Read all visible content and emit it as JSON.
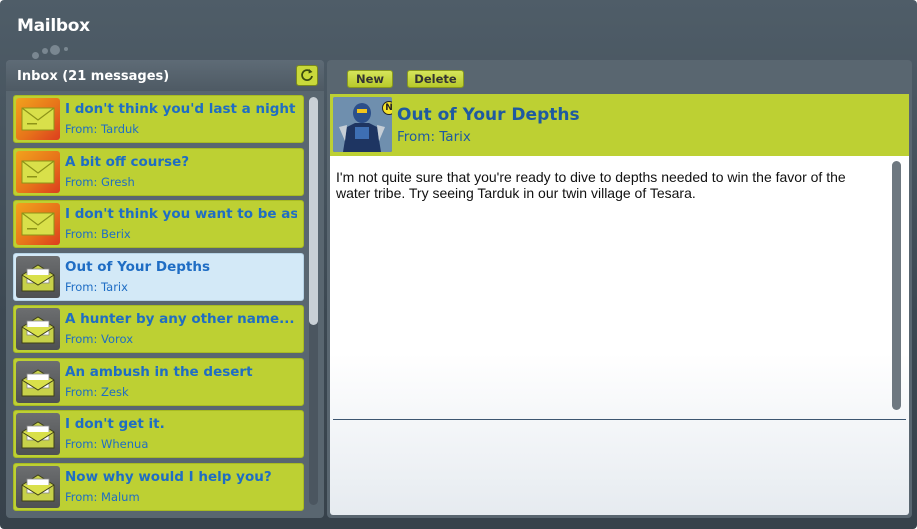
{
  "window": {
    "title": "Mailbox"
  },
  "inbox": {
    "title": "Inbox (21 messages)",
    "messages": [
      {
        "subject": "I don't think you'd last a night in the",
        "from": "From: Tarduk",
        "unread": true
      },
      {
        "subject": "A bit off course?",
        "from": "From: Gresh",
        "unread": true
      },
      {
        "subject": "I don't think you want to be associated",
        "from": "From: Berix",
        "unread": true
      },
      {
        "subject": "Out of Your Depths",
        "from": "From: Tarix",
        "unread": false,
        "selected": true
      },
      {
        "subject": "A hunter by any other name...",
        "from": "From: Vorox",
        "unread": false
      },
      {
        "subject": "An ambush in the desert",
        "from": "From: Zesk",
        "unread": false
      },
      {
        "subject": "I don't get it.",
        "from": "From: Whenua",
        "unread": false
      },
      {
        "subject": "Now why would I help you?",
        "from": "From: Malum",
        "unread": false
      }
    ]
  },
  "toolbar": {
    "new_label": "New",
    "delete_label": "Delete"
  },
  "reader": {
    "badge": "N",
    "subject": "Out of Your Depths",
    "from": "From: Tarix",
    "body": "I'm not quite sure that you're ready to dive to depths needed to win the favor of the water tribe. Try seeing Tarduk in our twin village of Tesara."
  },
  "colors": {
    "accent": "#bdd033",
    "link": "#1f6dc4",
    "chrome": "#3c4852",
    "selected": "#d3e9f7",
    "unread_icon": "#e7741a"
  },
  "icons": {
    "refresh": "refresh-icon",
    "unread": "envelope-closed-icon",
    "read": "envelope-open-icon"
  }
}
